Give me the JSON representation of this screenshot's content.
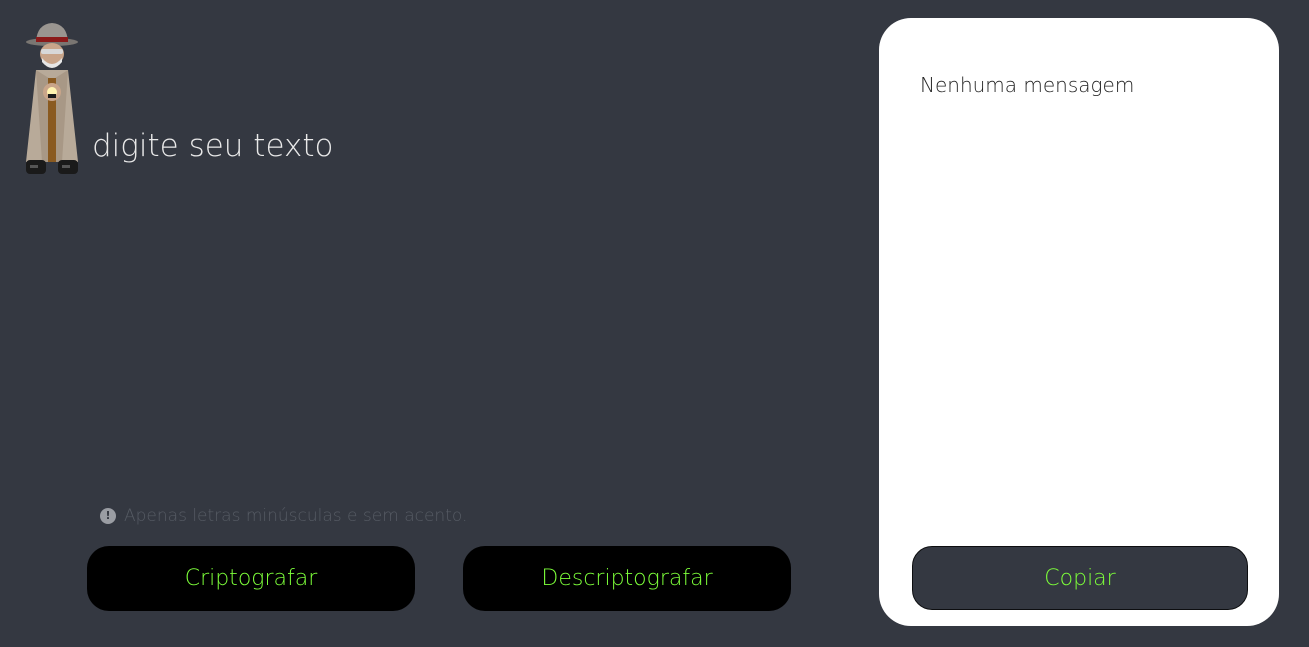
{
  "logo": {
    "icon": "detective-icon"
  },
  "input": {
    "placeholder": "digite seu texto",
    "value": ""
  },
  "hint": {
    "icon": "info-icon",
    "glyph": "!",
    "text": "Apenas letras minúsculas e sem acento."
  },
  "actions": {
    "encrypt_label": "Criptografar",
    "decrypt_label": "Descriptografar"
  },
  "output": {
    "text": "Nenhuma mensagem",
    "copy_label": "Copiar"
  },
  "colors": {
    "background": "#343841",
    "accent_text": "#7dff3a",
    "button_bg": "#000000",
    "card_bg": "#ffffff",
    "hint_text": "#565b64"
  }
}
